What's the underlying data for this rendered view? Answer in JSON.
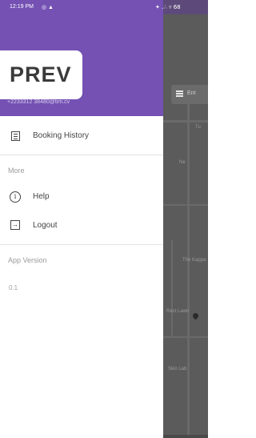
{
  "status_bar": {
    "time": "12:19 PM",
    "left_icons": "◎ ▲",
    "right_icons": "✦ .∴ ▿ 68"
  },
  "header": {
    "brand": "PREV",
    "email": "+2233312 38480@tim.cv"
  },
  "menu": {
    "booking_history": "Booking History",
    "more_section": "More",
    "help": "Help",
    "logout": "Logout",
    "app_version_section": "App Version",
    "app_version_value": "0.1"
  },
  "map": {
    "search_placeholder": "Ent",
    "labels": [
      "Tu",
      "Ne",
      "The Kappa",
      "Rect Lawn",
      "Skin Lab"
    ]
  },
  "colors": {
    "primary": "#7451b3",
    "map_overlay": "#5b5b5b"
  }
}
